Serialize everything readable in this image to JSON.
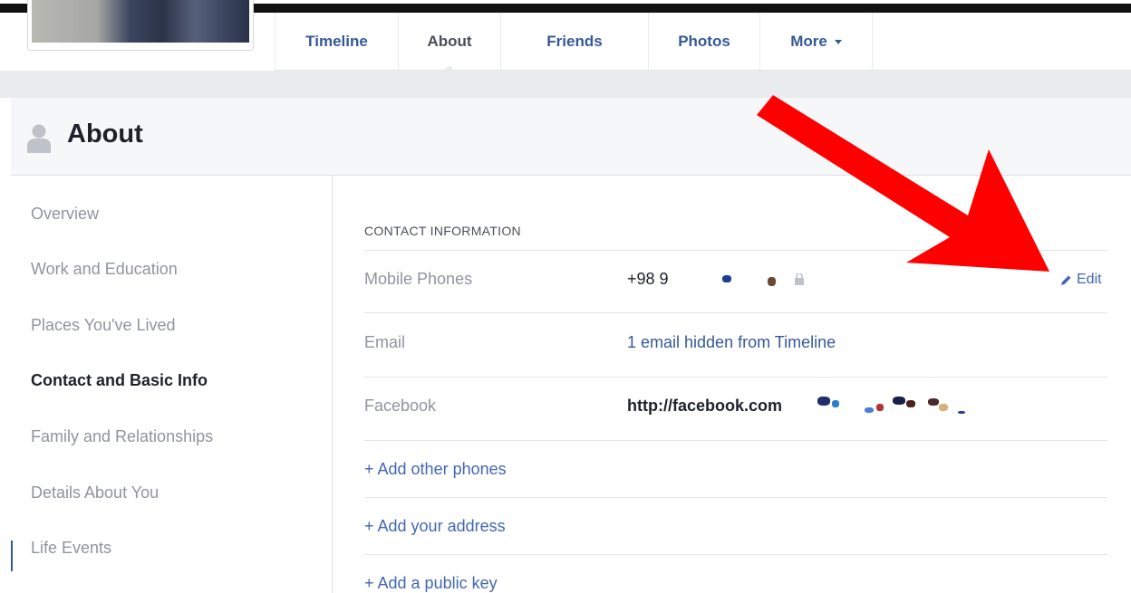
{
  "nav": {
    "tabs": [
      {
        "label": "Timeline"
      },
      {
        "label": "About"
      },
      {
        "label": "Friends"
      },
      {
        "label": "Photos"
      },
      {
        "label": "More"
      }
    ]
  },
  "about_header": {
    "title": "About",
    "icon": "person-icon"
  },
  "sidebar": {
    "items": [
      {
        "label": "Overview"
      },
      {
        "label": "Work and Education"
      },
      {
        "label": "Places You've Lived"
      },
      {
        "label": "Contact and Basic Info"
      },
      {
        "label": "Family and Relationships"
      },
      {
        "label": "Details About You"
      },
      {
        "label": "Life Events"
      }
    ],
    "active": "Contact and Basic Info"
  },
  "contact": {
    "section_title": "CONTACT INFORMATION",
    "rows": [
      {
        "label": "Mobile Phones",
        "value": "+98 9"
      },
      {
        "label": "Email",
        "value": "1 email hidden from Timeline"
      },
      {
        "label": "Facebook",
        "value": "http://facebook.com"
      }
    ],
    "edit_label": "Edit",
    "add_links": [
      {
        "label": "+ Add other phones"
      },
      {
        "label": "+ Add your address"
      },
      {
        "label": "+ Add a public key"
      }
    ]
  },
  "colors": {
    "link": "#365899",
    "arrow": "#ff0000",
    "muted": "#90949c"
  }
}
